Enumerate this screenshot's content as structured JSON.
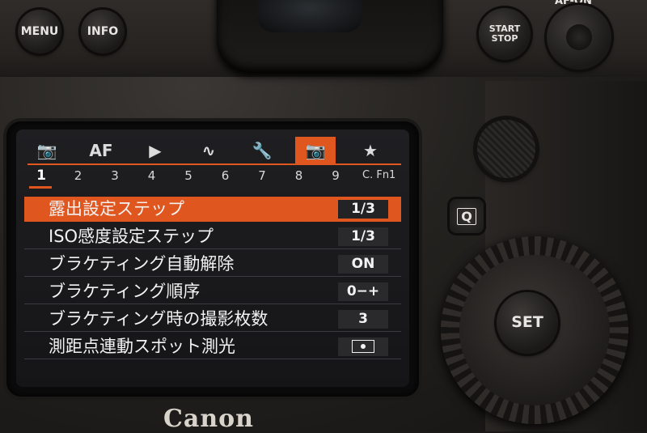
{
  "camera": {
    "menu_label": "MENU",
    "info_label": "INFO",
    "start_label": "START",
    "stop_label": "STOP",
    "af_on_label": "AF-ON",
    "q_label": "Q",
    "set_label": "SET",
    "brand": "Canon"
  },
  "screen": {
    "accent_color": "#e0561f",
    "tabs": [
      {
        "icon": "camera-icon",
        "glyph": "📷",
        "active": false
      },
      {
        "icon": "af-label",
        "glyph": "AF",
        "active": false
      },
      {
        "icon": "playback-icon",
        "glyph": "▶",
        "active": false
      },
      {
        "icon": "wireless-icon",
        "glyph": "∿",
        "active": false
      },
      {
        "icon": "wrench-icon",
        "glyph": "🔧",
        "active": false
      },
      {
        "icon": "custom-functions-icon",
        "glyph": "📷",
        "active": true
      },
      {
        "icon": "star-icon",
        "glyph": "★",
        "active": false
      }
    ],
    "pages": [
      "1",
      "2",
      "3",
      "4",
      "5",
      "6",
      "7",
      "8",
      "9"
    ],
    "active_page": "1",
    "cfn_label": "C. Fn1",
    "items": [
      {
        "label": "露出設定ステップ",
        "value": "1/3",
        "selected": true
      },
      {
        "label": "ISO感度設定ステップ",
        "value": "1/3",
        "selected": false
      },
      {
        "label": "ブラケティング自動解除",
        "value": "ON",
        "selected": false
      },
      {
        "label": "ブラケティング順序",
        "value": "0−+",
        "selected": false
      },
      {
        "label": "ブラケティング時の撮影枚数",
        "value": "3",
        "selected": false
      },
      {
        "label": "測距点連動スポット測光",
        "value": "",
        "value_icon": "spot-metering-icon",
        "selected": false
      }
    ]
  }
}
